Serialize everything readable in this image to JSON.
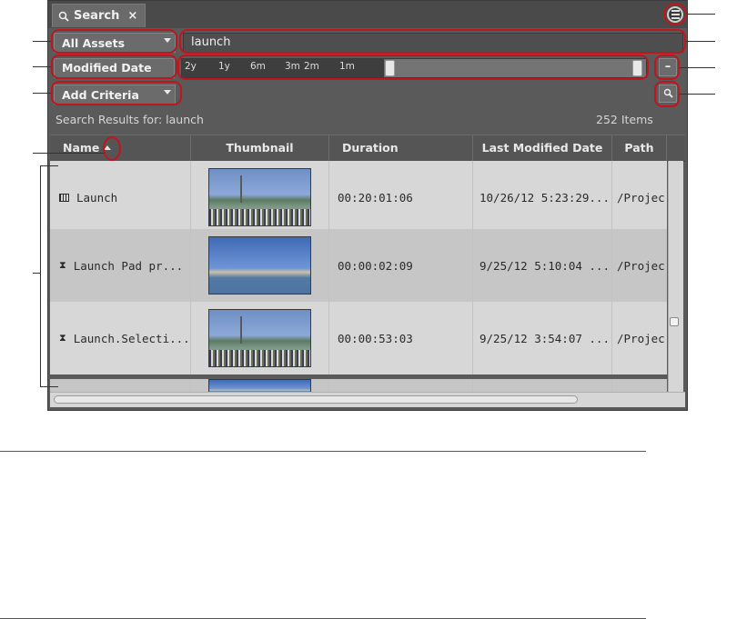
{
  "tab": {
    "label": "Search",
    "close_glyph": "×",
    "icon": "search-icon"
  },
  "panel_menu": {
    "icon": "hamburger-menu-icon"
  },
  "scope": {
    "selected": "All Assets"
  },
  "search": {
    "value": "launch"
  },
  "date_filter": {
    "label": "Modified Date",
    "ticks": [
      "2y",
      "1y",
      "6m",
      "3m",
      "2m",
      "1m"
    ],
    "remove_label": "–"
  },
  "criteria": {
    "selected": "Add Criteria"
  },
  "find_button": {
    "icon": "magnifier-icon"
  },
  "results": {
    "label": "Search Results for: launch",
    "count": "252 Items"
  },
  "table": {
    "columns": [
      "Name",
      "Thumbnail",
      "Duration",
      "Last Modified Date",
      "Path"
    ],
    "sort_icon": "sort-ascending-icon",
    "rows": [
      {
        "name": "Launch",
        "type_icon": "master-clip-icon",
        "duration": "00:20:01:06",
        "modified": "10/26/12 5:23:29...",
        "path": "/Projec"
      },
      {
        "name": "Launch Pad pr...",
        "type_icon": "subclip-icon",
        "duration": "00:00:02:09",
        "modified": "9/25/12 5:10:04 ...",
        "path": "/Projec"
      },
      {
        "name": "Launch.Selecti...",
        "type_icon": "subclip-icon",
        "duration": "00:00:53:03",
        "modified": "9/25/12 3:54:07 ...",
        "path": "/Projec"
      }
    ]
  },
  "colors": {
    "highlight": "#c0151d",
    "panel_bg": "#5a5a5a",
    "row_light": "#d7d7d7",
    "row_dark": "#c6c6c6"
  }
}
